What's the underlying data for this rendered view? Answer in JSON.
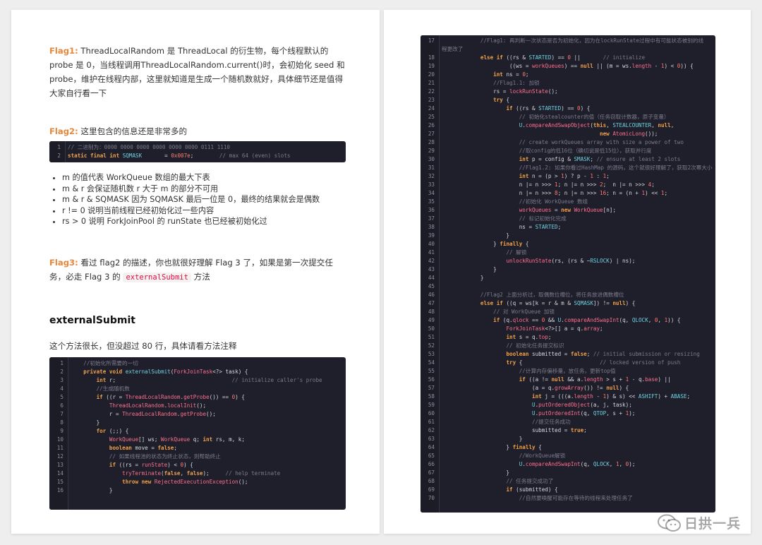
{
  "left_page": {
    "flag1": {
      "label": "Flag1:",
      "text": " ThreadLocalRandom 是 ThreadLocal 的衍生物，每个线程默认的 probe 是 0，当线程调用ThreadLocalRandom.current()时，会初始化 seed 和 probe，维护在线程内部，这里就知道是生成一个随机数就好，具体细节还是值得大家自行看一下"
    },
    "flag2": {
      "label": "Flag2:",
      "text": " 这里包含的信息还是非常多的"
    },
    "flag2_code": [
      {
        "n": "1",
        "html": "<span class=\"c\">// 二进制为：0000 0000 0000 0000 0000 0000 0111 1110</span>"
      },
      {
        "n": "2",
        "html": "<span class=\"k\">static final int</span> <span class=\"t\">SQMASK</span>       = <span class=\"n\">0x007e</span>;        <span class=\"c\">// max 64 (even) slots</span>"
      }
    ],
    "bullets": [
      "m 的值代表 WorkQueue 数组的最大下表",
      "m & r 会保证随机数 r 大于 m 的部分不可用",
      "m & r & SQMASK 因为 SQMASK 最后一位是 0，最终的结果就会是偶数",
      "r != 0 说明当前线程已经初始化过一些内容",
      "rs > 0 说明 ForkJoinPool 的 runState 也已经被初始化过"
    ],
    "flag3": {
      "label": "Flag3:",
      "text_before": " 看过 flag2 的描述，你也就很好理解 Flag 3 了，如果是第一次提交任务，必走 Flag 3 的 ",
      "code_word": "externalSubmit",
      "text_after": " 方法"
    },
    "heading": "externalSubmit",
    "intro": "这个方法很长，但没超过 80 行，具体请看方法注释",
    "code": [
      {
        "n": "1",
        "html": "    <span class=\"c\">//初始化所需要的一切</span>"
      },
      {
        "n": "2",
        "html": "    <span class=\"k\">private void</span> <span class=\"t\">externalSubmit</span>(<span class=\"f\">ForkJoinTask</span>&lt;?&gt; task) {"
      },
      {
        "n": "3",
        "html": "        <span class=\"k\">int</span> r;                                    <span class=\"c\">// initialize caller's probe</span>"
      },
      {
        "n": "4",
        "html": "        <span class=\"c\">//生成随机数</span>"
      },
      {
        "n": "5",
        "html": "        <span class=\"k\">if</span> ((r = <span class=\"f\">ThreadLocalRandom</span>.<span class=\"f\">getProbe</span>()) == <span class=\"n\">0</span>) {"
      },
      {
        "n": "6",
        "html": "            <span class=\"f\">ThreadLocalRandom</span>.<span class=\"f\">localInit</span>();"
      },
      {
        "n": "7",
        "html": "            r = <span class=\"f\">ThreadLocalRandom</span>.<span class=\"f\">getProbe</span>();"
      },
      {
        "n": "8",
        "html": "        }"
      },
      {
        "n": "9",
        "html": "        <span class=\"k\">for</span> (;;) {"
      },
      {
        "n": "10",
        "html": "            <span class=\"f\">WorkQueue</span>[] ws; <span class=\"f\">WorkQueue</span> q; <span class=\"k\">int</span> rs, m, k;"
      },
      {
        "n": "11",
        "html": "            <span class=\"k\">boolean</span> move = <span class=\"k\">false</span>;"
      },
      {
        "n": "12",
        "html": "            <span class=\"c\">// 如果线程池的状态为终止状态，则帮助终止</span>"
      },
      {
        "n": "13",
        "html": "            <span class=\"k\">if</span> ((rs = <span class=\"f\">runState</span>) &lt; <span class=\"n\">0</span>) {"
      },
      {
        "n": "14",
        "html": "                <span class=\"f\">tryTerminate</span>(<span class=\"k\">false</span>, <span class=\"k\">false</span>);     <span class=\"c\">// help terminate</span>"
      },
      {
        "n": "15",
        "html": "                <span class=\"k\">throw new</span> <span class=\"f\">RejectedExecutionException</span>();"
      },
      {
        "n": "16",
        "html": "            }"
      }
    ]
  },
  "right_page": {
    "code": [
      {
        "n": "17",
        "html": "            <span class=\"c\">//Flag1: 再判断一次状态是否为初始化，因为在lockRunState过程中有可能状态被别的线</span>"
      },
      {
        "n": "",
        "html": "<span class=\"c\">程更改了</span>"
      },
      {
        "n": "18",
        "html": "            <span class=\"k\">else if</span> ((rs &amp; <span class=\"t\">STARTED</span>) == <span class=\"n\">0</span> ||       <span class=\"c\">// initialize</span>"
      },
      {
        "n": "19",
        "html": "                     ((ws = <span class=\"f\">workQueues</span>) == <span class=\"k\">null</span> || (m = ws.<span class=\"f\">length</span> - <span class=\"n\">1</span>) &lt; <span class=\"n\">0</span>)) {"
      },
      {
        "n": "20",
        "html": "                <span class=\"k\">int</span> ns = <span class=\"n\">0</span>;"
      },
      {
        "n": "21",
        "html": "                <span class=\"c\">//Flag1.1: 加锁</span>"
      },
      {
        "n": "22",
        "html": "                rs = <span class=\"f\">lockRunState</span>();"
      },
      {
        "n": "23",
        "html": "                <span class=\"k\">try</span> {"
      },
      {
        "n": "24",
        "html": "                    <span class=\"k\">if</span> ((rs &amp; <span class=\"t\">STARTED</span>) == <span class=\"n\">0</span>) {"
      },
      {
        "n": "25",
        "html": "                        <span class=\"c\">// 初始化stealcounter的值（任务窃取计数器，原子变量）</span>"
      },
      {
        "n": "26",
        "html": "                        <span class=\"t\">U</span>.<span class=\"f\">compareAndSwapObject</span>(<span class=\"k\">this</span>, <span class=\"t\">STEALCOUNTER</span>, <span class=\"k\">null</span>,"
      },
      {
        "n": "27",
        "html": "                                                 <span class=\"k\">new</span> <span class=\"f\">AtomicLong</span>());"
      },
      {
        "n": "28",
        "html": "                        <span class=\"c\">// create workQueues array with size a power of two</span>"
      },
      {
        "n": "29",
        "html": "                        <span class=\"c\">//取config的低16位（确切说是低15位），获取并行度</span>"
      },
      {
        "n": "30",
        "html": "                        <span class=\"k\">int</span> p = config &amp; <span class=\"t\">SMASK</span>; <span class=\"c\">// ensure at least 2 slots</span>"
      },
      {
        "n": "31",
        "html": "                        <span class=\"c\">//Flag1.2: 如果你看过HashMap 的源码，这个就很好理解了，获取2次幂大小</span>"
      },
      {
        "n": "32",
        "html": "                        <span class=\"k\">int</span> n = (p &gt; <span class=\"n\">1</span>) ? p - <span class=\"n\">1</span> : <span class=\"n\">1</span>;"
      },
      {
        "n": "33",
        "html": "                        n |= n &gt;&gt;&gt; <span class=\"n\">1</span>; n |= n &gt;&gt;&gt; <span class=\"n\">2</span>;  n |= n &gt;&gt;&gt; <span class=\"n\">4</span>;"
      },
      {
        "n": "34",
        "html": "                        n |= n &gt;&gt;&gt; <span class=\"n\">8</span>; n |= n &gt;&gt;&gt; <span class=\"n\">16</span>; n = (n + <span class=\"n\">1</span>) &lt;&lt; <span class=\"n\">1</span>;"
      },
      {
        "n": "35",
        "html": "                        <span class=\"c\">//初始化 WorkQueue 数组</span>"
      },
      {
        "n": "36",
        "html": "                        <span class=\"f\">workQueues</span> = <span class=\"k\">new</span> <span class=\"f\">WorkQueue</span>[n];"
      },
      {
        "n": "37",
        "html": "                        <span class=\"c\">// 标记初始化完成</span>"
      },
      {
        "n": "38",
        "html": "                        ns = <span class=\"t\">STARTED</span>;"
      },
      {
        "n": "39",
        "html": "                    }"
      },
      {
        "n": "40",
        "html": "                } <span class=\"k\">finally</span> {"
      },
      {
        "n": "41",
        "html": "                    <span class=\"c\">// 解锁</span>"
      },
      {
        "n": "42",
        "html": "                    <span class=\"f\">unlockRunState</span>(rs, (rs &amp; ~<span class=\"t\">RSLOCK</span>) | ns);"
      },
      {
        "n": "43",
        "html": "                }"
      },
      {
        "n": "44",
        "html": "            }"
      },
      {
        "n": "45",
        "html": ""
      },
      {
        "n": "46",
        "html": "            <span class=\"c\">//Flag2 上面分析过，取偶数位槽位，将任务放进偶数槽位</span>"
      },
      {
        "n": "47",
        "html": "            <span class=\"k\">else if</span> ((q = ws[k = r &amp; m &amp; <span class=\"t\">SQMASK</span>]) != <span class=\"k\">null</span>) {"
      },
      {
        "n": "48",
        "html": "                <span class=\"c\">// 对 WorkQueue 加锁</span>"
      },
      {
        "n": "49",
        "html": "                <span class=\"k\">if</span> (q.<span class=\"f\">qlock</span> == <span class=\"n\">0</span> &amp;&amp; <span class=\"t\">U</span>.<span class=\"f\">compareAndSwapInt</span>(q, <span class=\"t\">QLOCK</span>, <span class=\"n\">0</span>, <span class=\"n\">1</span>)) {"
      },
      {
        "n": "50",
        "html": "                    <span class=\"f\">ForkJoinTask</span>&lt;?&gt;[] a = q.<span class=\"f\">array</span>;"
      },
      {
        "n": "51",
        "html": "                    <span class=\"k\">int</span> s = q.<span class=\"f\">top</span>;"
      },
      {
        "n": "52",
        "html": "                    <span class=\"c\">// 初始化任务提交标识</span>"
      },
      {
        "n": "53",
        "html": "                    <span class=\"k\">boolean</span> submitted = <span class=\"k\">false</span>; <span class=\"c\">// initial submission or resizing</span>"
      },
      {
        "n": "54",
        "html": "                    <span class=\"k\">try</span> {                        <span class=\"c\">// locked version of push</span>"
      },
      {
        "n": "55",
        "html": "                        <span class=\"c\">//计算内存偏移量，放任务，更新top值</span>"
      },
      {
        "n": "56",
        "html": "                        <span class=\"k\">if</span> ((a != <span class=\"k\">null</span> &amp;&amp; a.<span class=\"f\">length</span> &gt; s + <span class=\"n\">1</span> - q.<span class=\"f\">base</span>) ||"
      },
      {
        "n": "57",
        "html": "                            (a = q.<span class=\"f\">growArray</span>()) != <span class=\"k\">null</span>) {"
      },
      {
        "n": "58",
        "html": "                            <span class=\"k\">int</span> j = (((a.<span class=\"f\">length</span> - <span class=\"n\">1</span>) &amp; s) &lt;&lt; <span class=\"t\">ASHIFT</span>) + <span class=\"t\">ABASE</span>;"
      },
      {
        "n": "59",
        "html": "                            <span class=\"t\">U</span>.<span class=\"f\">putOrderedObject</span>(a, j, task);"
      },
      {
        "n": "60",
        "html": "                            <span class=\"t\">U</span>.<span class=\"f\">putOrderedInt</span>(q, <span class=\"t\">QTOP</span>, s + <span class=\"n\">1</span>);"
      },
      {
        "n": "61",
        "html": "                            <span class=\"c\">//提交任务成功</span>"
      },
      {
        "n": "62",
        "html": "                            submitted = <span class=\"k\">true</span>;"
      },
      {
        "n": "63",
        "html": "                        }"
      },
      {
        "n": "64",
        "html": "                    } <span class=\"k\">finally</span> {"
      },
      {
        "n": "65",
        "html": "                        <span class=\"c\">//WorkQueue解锁</span>"
      },
      {
        "n": "66",
        "html": "                        <span class=\"t\">U</span>.<span class=\"f\">compareAndSwapInt</span>(q, <span class=\"t\">QLOCK</span>, <span class=\"n\">1</span>, <span class=\"n\">0</span>);"
      },
      {
        "n": "67",
        "html": "                    }"
      },
      {
        "n": "68",
        "html": "                    <span class=\"c\">// 任务提交成功了</span>"
      },
      {
        "n": "69",
        "html": "                    <span class=\"k\">if</span> (submitted) {"
      },
      {
        "n": "70",
        "html": "                        <span class=\"c\">//自然要唤醒可能存在等待的线程来处理任务了</span>"
      }
    ]
  },
  "watermark": "日拱一兵"
}
